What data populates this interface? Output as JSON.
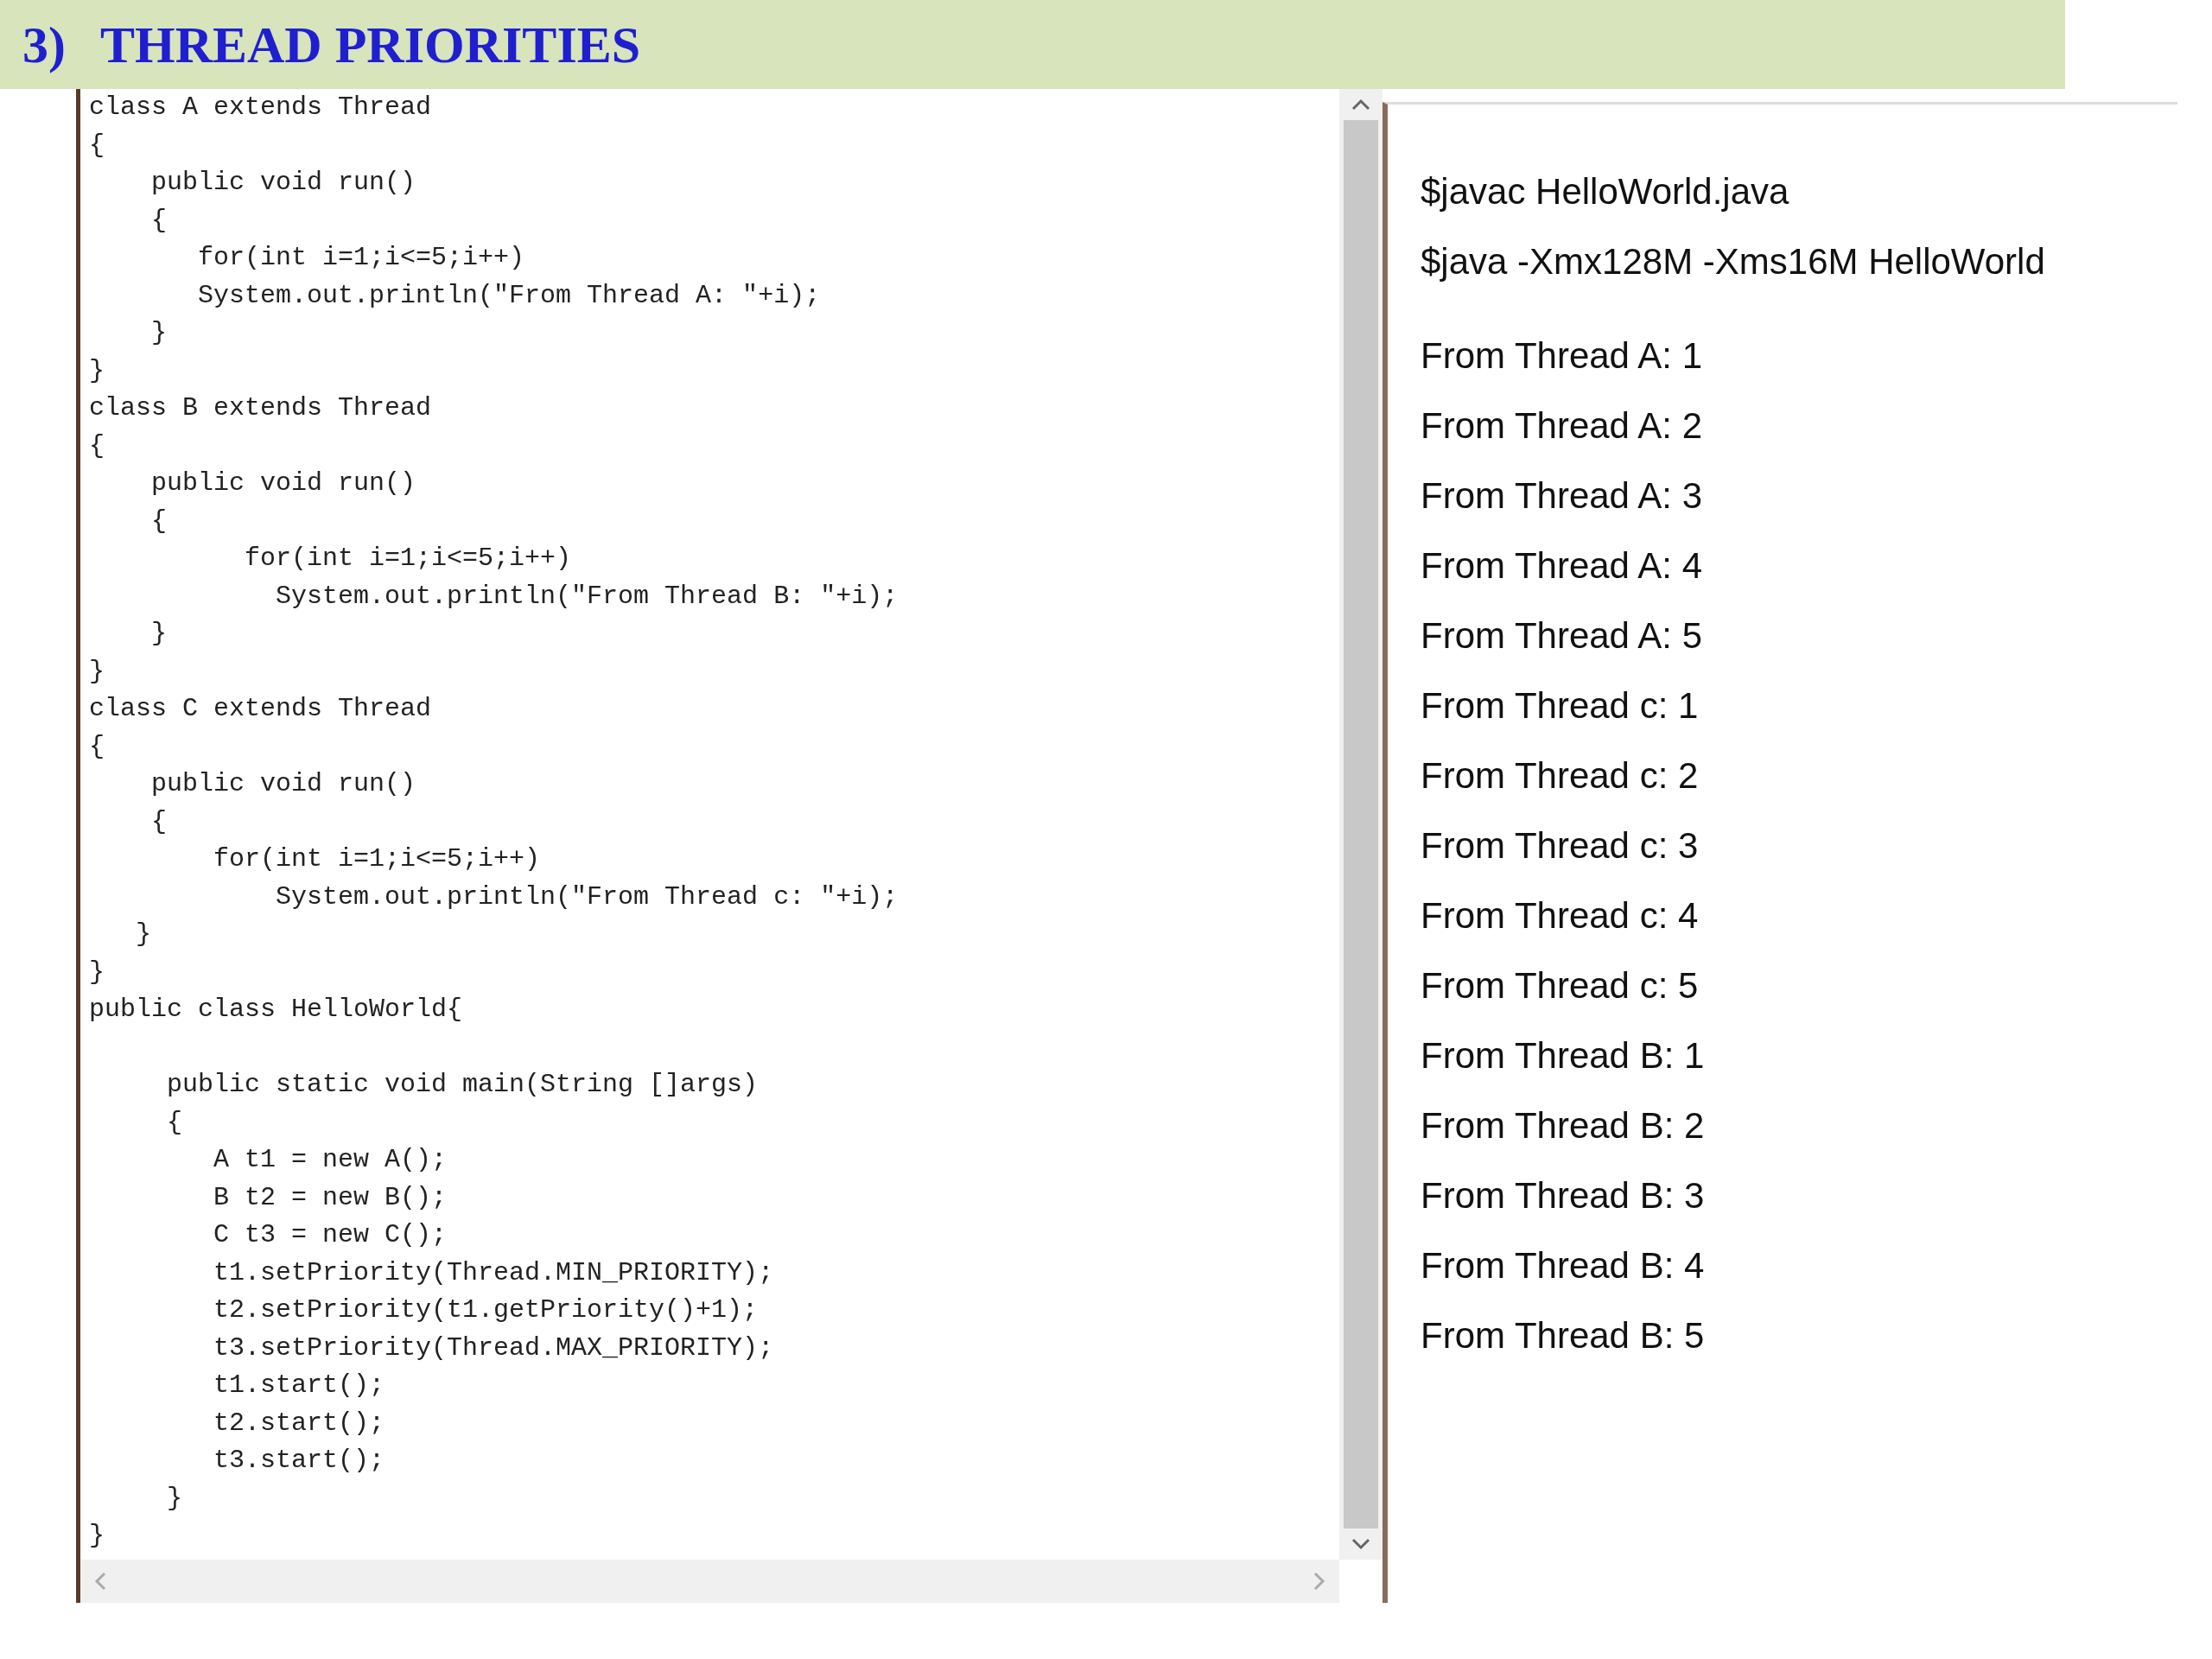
{
  "header": {
    "number": "3)",
    "title": "THREAD PRIORITIES"
  },
  "code": {
    "blocks": [
      [
        "class A extends Thread",
        "{",
        "    public void run()",
        "    {",
        "       for(int i=1;i<=5;i++)",
        "       System.out.println(\"From Thread A: \"+i);",
        "    }",
        "}",
        "class B extends Thread",
        "{",
        "    public void run()",
        "    {",
        "          for(int i=1;i<=5;i++)",
        "            System.out.println(\"From Thread B: \"+i);",
        "    }",
        "}",
        "class C extends Thread",
        "{",
        "    public void run()",
        "    {",
        "        for(int i=1;i<=5;i++)",
        "            System.out.println(\"From Thread c: \"+i);",
        "   }",
        "}",
        "public class HelloWorld{"
      ],
      [
        "     public static void main(String []args)",
        "     {",
        "        A t1 = new A();",
        "        B t2 = new B();",
        "        C t3 = new C();",
        "        t1.setPriority(Thread.MIN_PRIORITY);",
        "        t2.setPriority(t1.getPriority()+1);",
        "        t3.setPriority(Thread.MAX_PRIORITY);",
        "        t1.start();",
        "        t2.start();",
        "        t3.start();",
        "     }",
        "}"
      ]
    ]
  },
  "output": {
    "commands": [
      "$javac HelloWorld.java",
      "$java -Xmx128M -Xms16M HelloWorld"
    ],
    "lines": [
      "From Thread A: 1",
      "From Thread A: 2",
      "From Thread A: 3",
      "From Thread A: 4",
      "From Thread A: 5",
      "From Thread c: 1",
      "From Thread c: 2",
      "From Thread c: 3",
      "From Thread c: 4",
      "From Thread c: 5",
      "From Thread B: 1",
      "From Thread B: 2",
      "From Thread B: 3",
      "From Thread B: 4",
      "From Thread B: 5"
    ]
  }
}
